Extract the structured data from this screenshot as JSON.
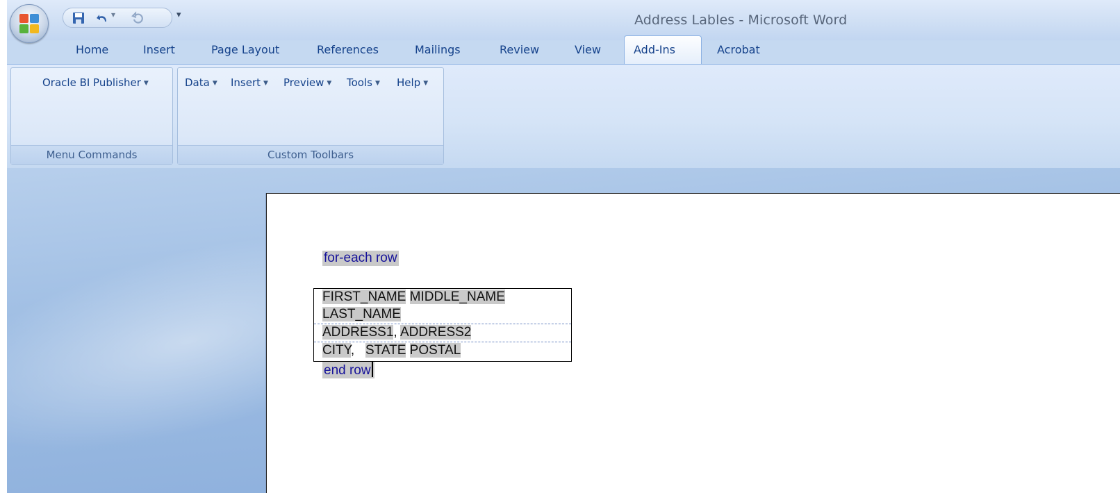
{
  "window": {
    "title": "Address Lables - Microsoft Word"
  },
  "quick_access": {
    "customize_glyph": "▾"
  },
  "tabs": [
    {
      "label": "Home"
    },
    {
      "label": "Insert"
    },
    {
      "label": "Page Layout"
    },
    {
      "label": "References"
    },
    {
      "label": "Mailings"
    },
    {
      "label": "Review"
    },
    {
      "label": "View"
    },
    {
      "label": "Add-Ins"
    },
    {
      "label": "Acrobat"
    }
  ],
  "active_tab": "Add-Ins",
  "ribbon": {
    "groups": [
      {
        "label": "Menu Commands",
        "buttons": [
          {
            "label": "Oracle BI Publisher"
          }
        ]
      },
      {
        "label": "Custom Toolbars",
        "buttons": [
          {
            "label": "Data"
          },
          {
            "label": "Insert"
          },
          {
            "label": "Preview"
          },
          {
            "label": "Tools"
          },
          {
            "label": "Help"
          }
        ]
      }
    ],
    "dropdown_glyph": "▼"
  },
  "document": {
    "for_each": "for-each row",
    "end_row": "end row",
    "address_lines": [
      [
        "FIRST_NAME",
        " ",
        "MIDDLE_NAME"
      ],
      [
        "LAST_NAME"
      ],
      [
        "ADDRESS1",
        ", ",
        "ADDRESS2"
      ],
      [
        "CITY",
        ",   ",
        "STATE",
        " ",
        "POSTAL"
      ]
    ]
  },
  "colors": {
    "ribbon_text": "#15428b",
    "field_shading": "#c9c9c9",
    "field_text": "#16129a"
  }
}
